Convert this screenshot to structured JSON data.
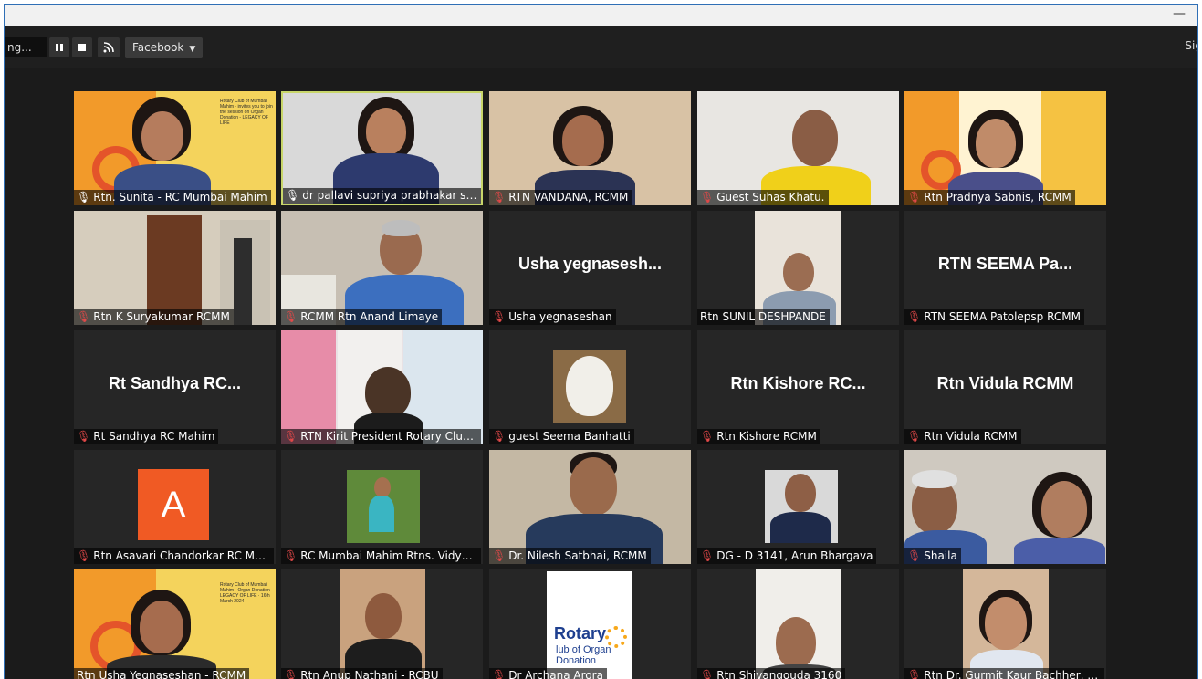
{
  "toolbar": {
    "title_fragment": "ng...",
    "stream_target": "Facebook",
    "sign_label": "Sig"
  },
  "tiles": [
    {
      "name": "Rtn. Sunita - RC Mumbai Mahim",
      "mic": "on"
    },
    {
      "name": "dr pallavi supriya prabhakar saple",
      "mic": "on"
    },
    {
      "name": "RTN VANDANA, RCMM",
      "mic": "muted"
    },
    {
      "name": "Guest Suhas Khatu.",
      "mic": "muted"
    },
    {
      "name": "Rtn Pradnya Sabnis, RCMM",
      "mic": "muted"
    },
    {
      "name": "Rtn K Suryakumar RCMM",
      "mic": "muted"
    },
    {
      "name": "RCMM Rtn Anand Limaye",
      "mic": "muted"
    },
    {
      "name": "Usha yegnaseshan",
      "mic": "muted",
      "display": "Usha  yegnasesh..."
    },
    {
      "name": "Rtn SUNIL DESHPANDE",
      "mic": "none"
    },
    {
      "name": "RTN SEEMA  Patolepsp RCMM",
      "mic": "muted",
      "display": "RTN SEEMA  Pa..."
    },
    {
      "name": "Rt Sandhya RC Mahim",
      "mic": "muted",
      "display": "Rt Sandhya RC..."
    },
    {
      "name": "RTN Kirit President Rotary Club of ...",
      "mic": "muted"
    },
    {
      "name": "guest Seema Banhatti",
      "mic": "muted"
    },
    {
      "name": "Rtn Kishore RCMM",
      "mic": "muted",
      "display": "Rtn  Kishore RC..."
    },
    {
      "name": "Rtn Vidula RCMM",
      "mic": "muted",
      "display": "Rtn Vidula RCMM"
    },
    {
      "name": "Rtn Asavari Chandorkar RC Mumb...",
      "mic": "muted",
      "avatar_letter": "A"
    },
    {
      "name": "RC Mumbai Mahim Rtns. Vidya an...",
      "mic": "muted"
    },
    {
      "name": "Dr. Nilesh Satbhai, RCMM",
      "mic": "muted"
    },
    {
      "name": "DG - D 3141, Arun Bhargava",
      "mic": "muted"
    },
    {
      "name": "Shaila",
      "mic": "muted"
    },
    {
      "name": "Rtn Usha Yegnaseshan - RCMM",
      "mic": "none"
    },
    {
      "name": "Rtn Anup Nathani - RCBU",
      "mic": "muted"
    },
    {
      "name": "Dr Archana Arora",
      "mic": "muted",
      "logo_title": "Rotary",
      "logo_sub": "lub of Organ Donation"
    },
    {
      "name": "Rtn Shivangouda 3160",
      "mic": "muted"
    },
    {
      "name": "Rtn Dr. Gurmit Kaur Bachher, Mu...",
      "mic": "muted"
    }
  ],
  "colors": {
    "active_speaker_border": "#c8d66a",
    "muted_mic": "#e04848",
    "window_border": "#2f6fb6",
    "background": "#1b1b1b",
    "tile": "#262626"
  },
  "icons": {
    "pause": "pause-icon",
    "stop": "stop-icon",
    "rss": "rss-icon",
    "mic_muted": "mic-muted-icon",
    "mic_on": "mic-icon"
  }
}
